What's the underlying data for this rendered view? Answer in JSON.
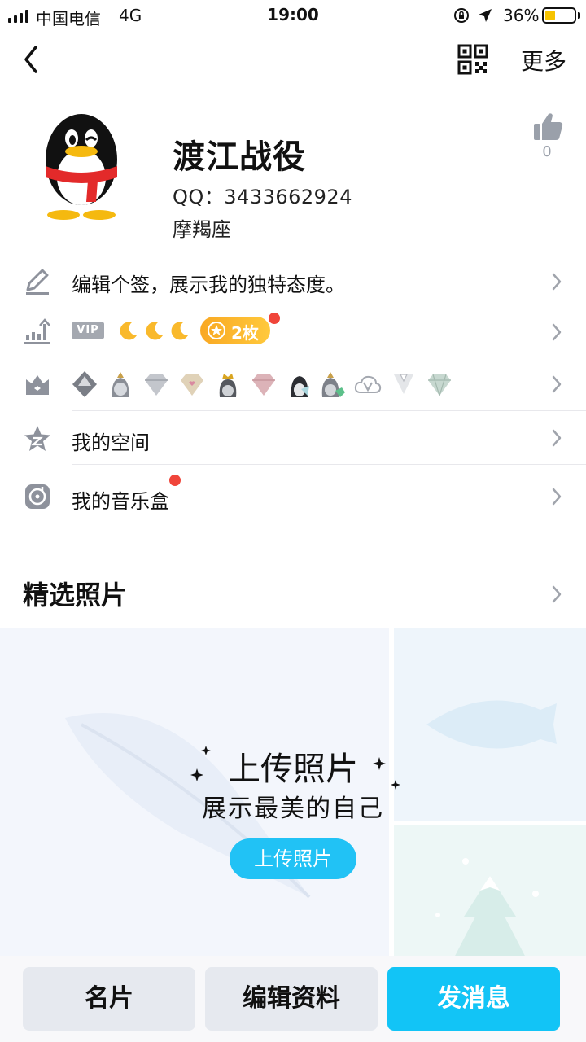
{
  "status_bar": {
    "carrier": "中国电信",
    "network": "4G",
    "time": "19:00",
    "battery_percent": "36%",
    "battery_level": 0.36,
    "icons": [
      "signal-icon",
      "orientation-lock-icon",
      "location-icon",
      "battery-icon"
    ]
  },
  "nav": {
    "back_icon": "chevron-left-icon",
    "qr_icon": "qr-code-icon",
    "more_label": "更多"
  },
  "profile": {
    "name": "渡江战役",
    "qq_label": "QQ：3433662924",
    "zodiac": "摩羯座",
    "like_count": "0"
  },
  "rows": {
    "signature": "编辑个签，展示我的独特态度。",
    "vip_tag": "VIP",
    "badge_count": "2枚",
    "space": "我的空间",
    "music": "我的音乐盒"
  },
  "section": {
    "title": "精选照片"
  },
  "photos": {
    "upload_title": "上传照片",
    "upload_subtitle": "展示最美的自己",
    "upload_button": "上传照片"
  },
  "bottom_bar": {
    "card": "名片",
    "edit_profile": "编辑资料",
    "send_message": "发消息"
  },
  "colors": {
    "accent": "#12c4f6",
    "badge_orange": "#f9a823",
    "red_dot": "#f0453a",
    "icon_grey": "#8e929c"
  }
}
